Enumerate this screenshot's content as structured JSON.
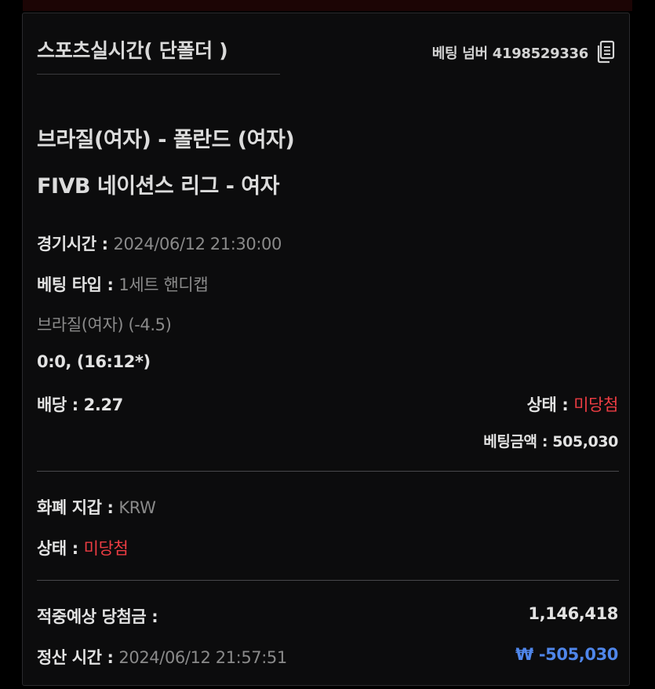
{
  "header": {
    "title": "스포츠실시간( 단폴더 )",
    "bet_number_label": "베팅 넘버 4198529336"
  },
  "match": {
    "teams": "브라질(여자) - 폴란드 (여자)",
    "league": "FIVB 네이션스 리그 - 여자"
  },
  "details": {
    "game_time_label": "경기시간 : ",
    "game_time_value": "2024/06/12 21:30:00",
    "bet_type_label": "베팅 타입 : ",
    "bet_type_value": "1세트 핸디캡",
    "selection": "브라질(여자) (-4.5)",
    "score": "0:0, (16:12*)",
    "odds_label": "배당 : ",
    "odds_value": "2.27",
    "status_label": "상태 : ",
    "status_value": "미당첨",
    "bet_amount_label": "베팅금액 : ",
    "bet_amount_value": "505,030"
  },
  "wallet": {
    "currency_label": "화폐 지갑 : ",
    "currency_value": "KRW",
    "status_label": "상태 : ",
    "status_value": "미당첨"
  },
  "settlement": {
    "expected_win_label": "적중예상 당첨금 : ",
    "expected_win_value": "1,146,418",
    "settle_time_label": "정산 시간 : ",
    "settle_time_value": "2024/06/12 21:57:51",
    "settle_amount": "₩ -505,030"
  },
  "colors": {
    "background": "#000000",
    "card": "#0c0c0d",
    "status_red": "#ee3d43",
    "amount_blue": "#4f86ea"
  },
  "icons": {
    "copy": "copy-document-icon"
  }
}
